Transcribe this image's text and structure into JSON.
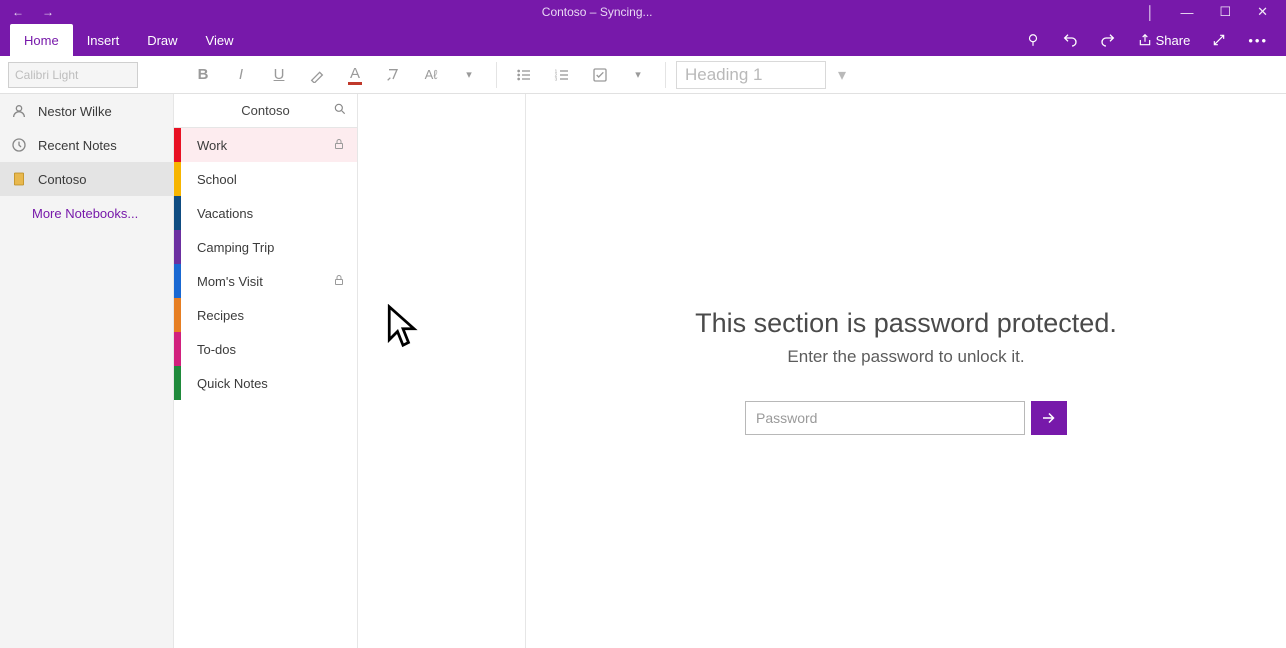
{
  "window": {
    "title": "Contoso – Syncing..."
  },
  "ribbon": {
    "tabs": [
      "Home",
      "Insert",
      "Draw",
      "View"
    ],
    "active_tab": "Home",
    "share_label": "Share",
    "font_name": "Calibri Light",
    "style_label": "Heading 1"
  },
  "sidebar": {
    "user": "Nestor Wilke",
    "recent": "Recent Notes",
    "notebook": "Contoso",
    "more": "More Notebooks..."
  },
  "sections": {
    "header": "Contoso",
    "items": [
      {
        "label": "Work",
        "color": "#E81123",
        "locked": true,
        "selected": true
      },
      {
        "label": "School",
        "color": "#F7B500",
        "locked": false,
        "selected": false
      },
      {
        "label": "Vacations",
        "color": "#0F4C81",
        "locked": false,
        "selected": false
      },
      {
        "label": "Camping Trip",
        "color": "#6B2FA0",
        "locked": false,
        "selected": false
      },
      {
        "label": "Mom's Visit",
        "color": "#1968D2",
        "locked": true,
        "selected": false
      },
      {
        "label": "Recipes",
        "color": "#E67E22",
        "locked": false,
        "selected": false
      },
      {
        "label": "To-dos",
        "color": "#D1207D",
        "locked": false,
        "selected": false
      },
      {
        "label": "Quick Notes",
        "color": "#1F8A3B",
        "locked": false,
        "selected": false
      }
    ]
  },
  "canvas": {
    "protected_heading": "This section is password protected.",
    "protected_sub": "Enter the password to unlock it.",
    "password_placeholder": "Password"
  }
}
